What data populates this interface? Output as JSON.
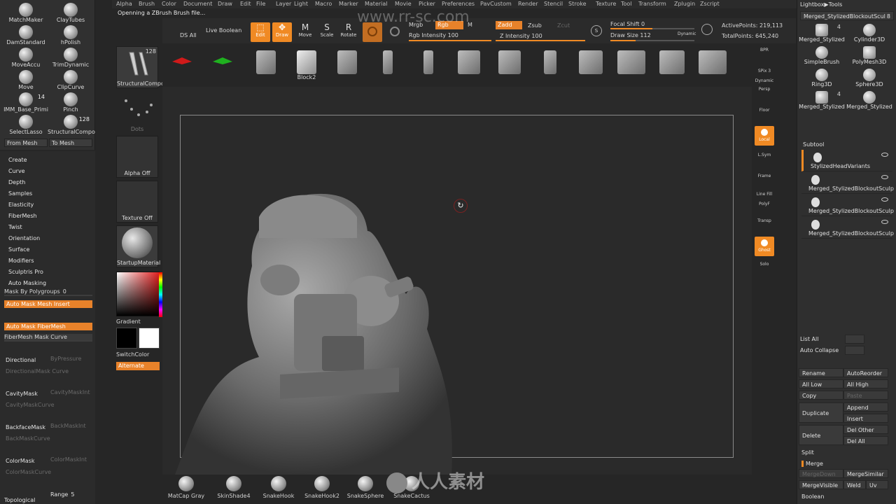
{
  "menu": [
    "Alpha",
    "Brush",
    "Color",
    "Document",
    "Draw",
    "Edit",
    "File",
    "Layer",
    "Light",
    "Macro",
    "Marker",
    "Material",
    "Movie",
    "Picker",
    "Preferences",
    "PavCustom",
    "Render",
    "Stencil",
    "Stroke",
    "Texture",
    "Tool",
    "Transform",
    "Zplugin",
    "Zscript"
  ],
  "status": "Openning a ZBrush Brush file...",
  "watermark_top": "www.rr-sc.com",
  "watermark_bottom": "人人素材",
  "brushes": [
    {
      "label": "MatchMaker"
    },
    {
      "label": "ClayTubes"
    },
    {
      "label": "DamStandard"
    },
    {
      "label": "hPolish"
    },
    {
      "label": "MoveAccu"
    },
    {
      "label": "TrimDynamic"
    },
    {
      "label": "Move"
    },
    {
      "label": "ClipCurve"
    },
    {
      "label": "IMM_Base_Primi",
      "num": "14"
    },
    {
      "label": "Pinch"
    },
    {
      "label": "SelectLasso"
    },
    {
      "label": "StructuralCompo",
      "num": "128"
    }
  ],
  "from_mesh": "From Mesh",
  "to_mesh": "To Mesh",
  "left_menu": [
    "Create",
    "Curve",
    "Depth",
    "Samples",
    "Elasticity",
    "FiberMesh",
    "Twist",
    "Orientation",
    "Surface",
    "Modifiers",
    "Sculptris Pro"
  ],
  "auto_masking": "Auto Masking",
  "mask_by_polygroups": "Mask By Polygroups",
  "mask_by_polygroups_value": "0",
  "auto_mask_mesh_insert": "Auto Mask Mesh Insert",
  "auto_mask_fibermesh": "Auto Mask FiberMesh",
  "fibermesh_mask_curve": "FiberMesh Mask Curve",
  "mask_rows": [
    {
      "a": "Directional",
      "b": "ByPressure",
      "c": "DirectionalMask Curve"
    },
    {
      "a": "CavityMask",
      "b": "CavityMaskInt",
      "c": "CavityMaskCurve"
    },
    {
      "a": "BackfaceMask",
      "b": "BackMaskInt",
      "c": "BackMaskCurve"
    },
    {
      "a": "ColorMask",
      "b": "ColorMaskInt",
      "c": "ColorMaskCurve"
    }
  ],
  "topological": "Topological",
  "range_label": "Range",
  "range_value": "5",
  "mid": {
    "structural_num": "128",
    "structural": "StructuralCompo",
    "dots": "Dots",
    "alpha_off": "Alpha Off",
    "texture_off": "Texture Off",
    "material": "StartupMaterial",
    "gradient": "Gradient",
    "switch_color": "SwitchColor",
    "alternate": "Alternate"
  },
  "toolbar": {
    "ds_all": "DS All",
    "live_boolean": "Live Boolean",
    "edit": "Edit",
    "draw": "Draw",
    "move": "Move",
    "scale": "Scale",
    "rotate": "Rotate",
    "mrgb": "Mrgb",
    "rgb": "Rgb",
    "m": "M",
    "zadd": "Zadd",
    "zsub": "Zsub",
    "zcut": "Zcut",
    "rgb_intensity": "Rgb Intensity 100",
    "z_intensity": "Z Intensity 100",
    "focal_shift": "Focal Shift 0",
    "draw_size": "Draw Size 112",
    "dynamic": "Dynamic",
    "active_points": "ActivePoints: 219,113",
    "total_points": "TotalPoints: 645,240"
  },
  "tools": [
    "Block2"
  ],
  "right_shelf": [
    "BPR",
    "SPix 3",
    "Dynamic",
    "Persp",
    "Floor",
    "Local",
    "L.Sym",
    "Frame",
    "Line Fill",
    "PolyF",
    "Transp",
    "Ghost",
    "Solo"
  ],
  "rpanel": {
    "lightbox_tools": "Lightbox▶Tools",
    "current_tool": "Merged_StylizedBlockoutScul",
    "current_tool_num": "8",
    "tools": [
      {
        "label": "Merged_Stylized",
        "num": "4"
      },
      {
        "label": "Cylinder3D"
      },
      {
        "label": "SimpleBrush"
      },
      {
        "label": "PolyMesh3D"
      },
      {
        "label": "Ring3D"
      },
      {
        "label": "Sphere3D"
      },
      {
        "label": "Merged_Stylized",
        "num": "4"
      },
      {
        "label": "Merged_Stylized"
      }
    ],
    "subtool_title": "Subtool",
    "subtools": [
      "StylizedHeadVariants",
      "Merged_StylizedBlockoutSculp",
      "Merged_StylizedBlockoutSculp",
      "Merged_StylizedBlockoutSculp"
    ],
    "list_all": "List All",
    "auto_collapse": "Auto Collapse",
    "buttons": [
      [
        "Rename",
        "AutoReorder"
      ],
      [
        "All Low",
        "All High"
      ],
      [
        "Copy",
        "Paste"
      ]
    ],
    "duplicate": "Duplicate",
    "append": "Append",
    "insert": "Insert",
    "delete": "Delete",
    "del_other": "Del Other",
    "del_all": "Del All",
    "split": "Split",
    "merge": "Merge",
    "merge_down": "MergeDown",
    "merge_similar": "MergeSimilar",
    "merge_visible": "MergeVisible",
    "weld": "Weld",
    "uv": "Uv",
    "boolean": "Boolean"
  },
  "materials": [
    "MatCap Gray",
    "SkinShade4",
    "SnakeHook",
    "SnakeHook2",
    "SnakeSphere",
    "SnakeCactus"
  ]
}
